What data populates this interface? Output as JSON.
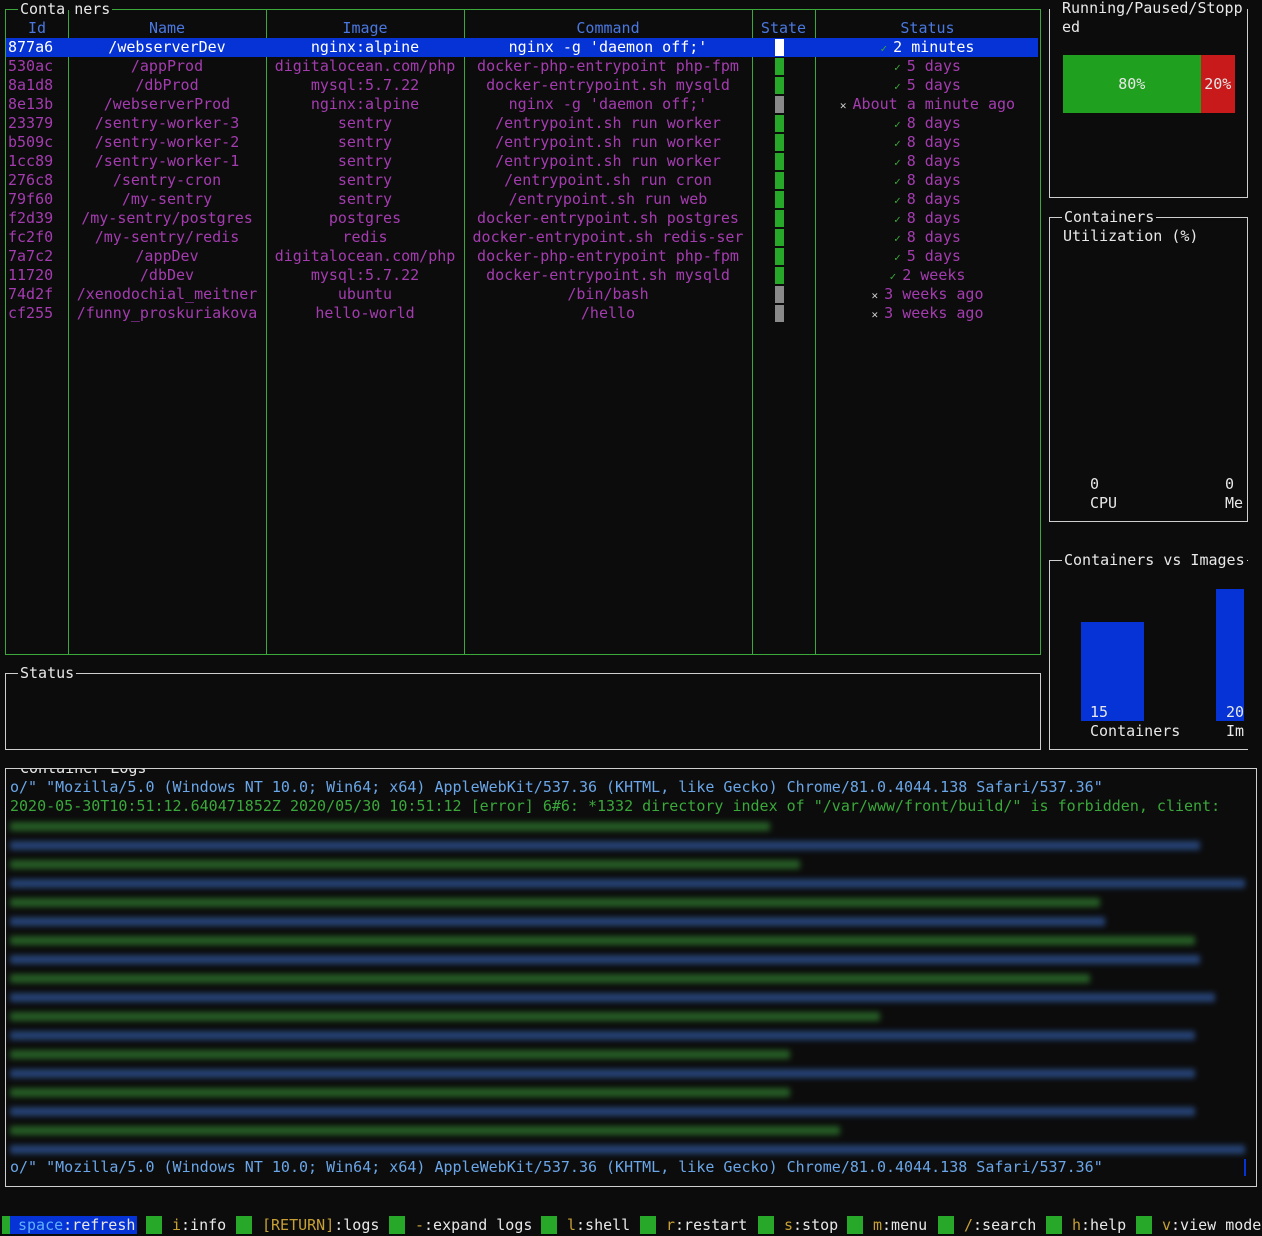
{
  "containers_panel": {
    "title_left": "Conta",
    "title_right": "ners",
    "columns": [
      "Id",
      "Name",
      "Image",
      "Command",
      "State",
      "Status"
    ],
    "rows": [
      {
        "id": "877a6",
        "name": "/webserverDev",
        "image": "nginx:alpine",
        "command": "nginx -g 'daemon off;'",
        "state": "running",
        "mark": "✓",
        "status": "2 minutes",
        "selected": true
      },
      {
        "id": "530ac",
        "name": "/appProd",
        "image": "digitalocean.com/php",
        "command": "docker-php-entrypoint php-fpm",
        "state": "running",
        "mark": "✓",
        "status": "5 days"
      },
      {
        "id": "8a1d8",
        "name": "/dbProd",
        "image": "mysql:5.7.22",
        "command": "docker-entrypoint.sh mysqld",
        "state": "running",
        "mark": "✓",
        "status": "5 days"
      },
      {
        "id": "8e13b",
        "name": "/webserverProd",
        "image": "nginx:alpine",
        "command": "nginx -g 'daemon off;'",
        "state": "stopped",
        "mark": "✕",
        "status": "About a minute ago"
      },
      {
        "id": "23379",
        "name": "/sentry-worker-3",
        "image": "sentry",
        "command": "/entrypoint.sh run worker",
        "state": "running",
        "mark": "✓",
        "status": "8 days"
      },
      {
        "id": "b509c",
        "name": "/sentry-worker-2",
        "image": "sentry",
        "command": "/entrypoint.sh run worker",
        "state": "running",
        "mark": "✓",
        "status": "8 days"
      },
      {
        "id": "1cc89",
        "name": "/sentry-worker-1",
        "image": "sentry",
        "command": "/entrypoint.sh run worker",
        "state": "running",
        "mark": "✓",
        "status": "8 days"
      },
      {
        "id": "276c8",
        "name": "/sentry-cron",
        "image": "sentry",
        "command": "/entrypoint.sh run cron",
        "state": "running",
        "mark": "✓",
        "status": "8 days"
      },
      {
        "id": "79f60",
        "name": "/my-sentry",
        "image": "sentry",
        "command": "/entrypoint.sh run web",
        "state": "running",
        "mark": "✓",
        "status": "8 days"
      },
      {
        "id": "f2d39",
        "name": "/my-sentry/postgres",
        "image": "postgres",
        "command": "docker-entrypoint.sh postgres",
        "state": "running",
        "mark": "✓",
        "status": "8 days"
      },
      {
        "id": "fc2f0",
        "name": "/my-sentry/redis",
        "image": "redis",
        "command": "docker-entrypoint.sh redis-ser",
        "state": "running",
        "mark": "✓",
        "status": "8 days"
      },
      {
        "id": "7a7c2",
        "name": "/appDev",
        "image": "digitalocean.com/php",
        "command": "docker-php-entrypoint php-fpm",
        "state": "running",
        "mark": "✓",
        "status": "5 days"
      },
      {
        "id": "11720",
        "name": "/dbDev",
        "image": "mysql:5.7.22",
        "command": "docker-entrypoint.sh mysqld",
        "state": "running",
        "mark": "✓",
        "status": "2 weeks"
      },
      {
        "id": "74d2f",
        "name": "/xenodochial_meitner",
        "image": "ubuntu",
        "command": "/bin/bash",
        "state": "stopped",
        "mark": "✕",
        "status": "3 weeks ago"
      },
      {
        "id": "cf255",
        "name": "/funny_proskuriakova",
        "image": "hello-world",
        "command": "/hello",
        "state": "stopped",
        "mark": "✕",
        "status": "3 weeks ago"
      }
    ],
    "state_colors": {
      "running": "#28a828",
      "stopped": "#8a8a8a",
      "selected": "#ffffff"
    }
  },
  "status_panel": {
    "title": "Status"
  },
  "rps_panel": {
    "title_line1": "Running/Paused/Stopp",
    "title_line2": "ed",
    "running_pct": 80,
    "running_label": "80%",
    "stopped_label": "20%",
    "running_color": "#1fa01f",
    "stopped_color": "#c81a1a"
  },
  "util_panel": {
    "title_line1": "Containers",
    "title_line2": "Utilization (%)",
    "cpu_value": "0",
    "cpu_label": "CPU",
    "mem_value": "0",
    "mem_label": "Me"
  },
  "cvi_panel": {
    "title": "Containers vs Images",
    "bar_color": "#0533d6",
    "containers_value": "15",
    "containers_label": "Containers",
    "images_value": "20",
    "images_label": "Im"
  },
  "chart_data": {
    "type": "bar",
    "title": "Containers vs Images",
    "categories": [
      "Containers",
      "Im"
    ],
    "values": [
      15,
      20
    ]
  },
  "logs_panel": {
    "title": "Container Logs",
    "first_line": "o/\" \"Mozilla/5.0 (Windows NT 10.0; Win64; x64) AppleWebKit/537.36 (KHTML, like Gecko) Chrome/81.0.4044.138 Safari/537.36\"",
    "second_line": "2020-05-30T10:51:12.640471852Z 2020/05/30 10:51:12 [error] 6#6: *1332 directory index of \"/var/www/front/build/\" is forbidden, client:",
    "last_line": "o/\" \"Mozilla/5.0 (Windows NT 10.0; Win64; x64) AppleWebKit/537.36 (KHTML, like Gecko) Chrome/81.0.4044.138 Safari/537.36\"",
    "first_color": "#6aa6e8",
    "error_color": "#3aa83a"
  },
  "keybar": [
    {
      "key": "space",
      "desc": ":refresh",
      "active": true
    },
    {
      "key": "i",
      "desc": ":info"
    },
    {
      "key": "[RETURN]",
      "desc": ":logs"
    },
    {
      "key": "-",
      "desc": ":expand logs"
    },
    {
      "key": "l",
      "desc": ":shell"
    },
    {
      "key": "r",
      "desc": ":restart"
    },
    {
      "key": "s",
      "desc": ":stop"
    },
    {
      "key": "m",
      "desc": ":menu"
    },
    {
      "key": "/",
      "desc": ":search"
    },
    {
      "key": "h",
      "desc": ":help"
    },
    {
      "key": "v",
      "desc": ":view mode"
    }
  ]
}
